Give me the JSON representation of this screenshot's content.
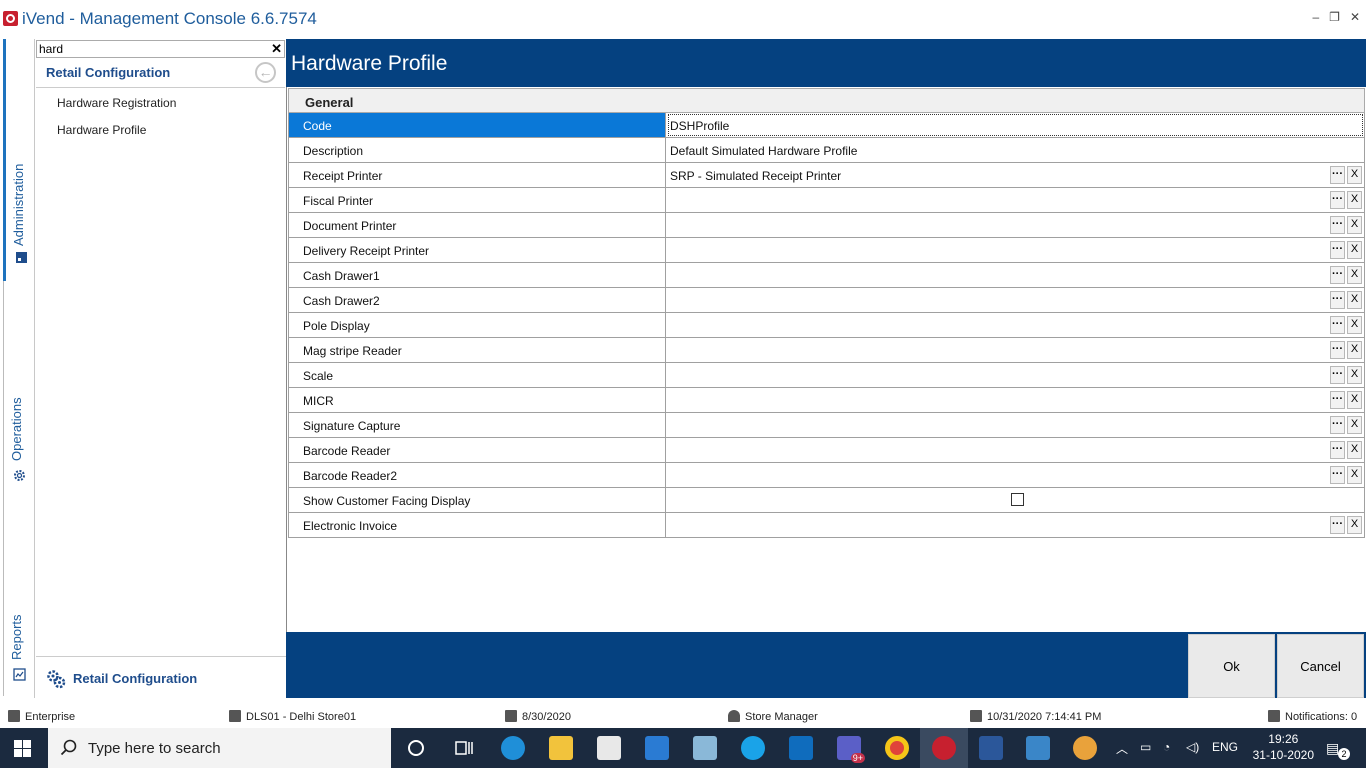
{
  "titlebar": {
    "title": "iVend - Management Console  6.6.7574",
    "minimize": "–",
    "restore": "❐",
    "close": "✕"
  },
  "rail": {
    "tabs": [
      "Administration",
      "Operations",
      "Reports"
    ]
  },
  "search": {
    "value": "hard",
    "clear": "✕"
  },
  "nav": {
    "title": "Retail Configuration",
    "back": "←",
    "items": [
      "Hardware Registration",
      "Hardware Profile"
    ],
    "bottom_label": "Retail Configuration"
  },
  "content": {
    "title": "Hardware Profile"
  },
  "grid": {
    "section": "General",
    "rows": [
      {
        "name": "Code",
        "value": "DSHProfile"
      },
      {
        "name": "Description",
        "value": "Default Simulated Hardware Profile"
      },
      {
        "name": "Receipt Printer",
        "value": "SRP - Simulated Receipt Printer"
      },
      {
        "name": "Fiscal Printer",
        "value": ""
      },
      {
        "name": "Document Printer",
        "value": ""
      },
      {
        "name": "Delivery Receipt Printer",
        "value": ""
      },
      {
        "name": "Cash Drawer1",
        "value": ""
      },
      {
        "name": "Cash Drawer2",
        "value": ""
      },
      {
        "name": "Pole Display",
        "value": ""
      },
      {
        "name": "Mag stripe Reader",
        "value": ""
      },
      {
        "name": "Scale",
        "value": ""
      },
      {
        "name": "MICR",
        "value": ""
      },
      {
        "name": "Signature Capture",
        "value": ""
      },
      {
        "name": "Barcode Reader",
        "value": ""
      },
      {
        "name": "Barcode Reader2",
        "value": ""
      },
      {
        "name": "Show Customer Facing Display",
        "value": ""
      },
      {
        "name": "Electronic Invoice",
        "value": ""
      }
    ],
    "more_label": "···",
    "clear_label": "X"
  },
  "buttons": {
    "ok": "Ok",
    "cancel": "Cancel"
  },
  "status": {
    "edition": "Enterprise",
    "store": "DLS01 - Delhi Store01",
    "business_date": "8/30/2020",
    "role": "Store Manager",
    "login_time": "10/31/2020 7:14:41 PM",
    "notifications": "Notifications: 0"
  },
  "taskbar": {
    "search_placeholder": "Type here to search",
    "language": "ENG",
    "time": "19:26",
    "date": "31-10-2020",
    "notif_count": "2",
    "teams_badge": "9+"
  },
  "colors": {
    "header": "#054180",
    "selection": "#0a78d7",
    "accent": "#1f5d9c"
  }
}
